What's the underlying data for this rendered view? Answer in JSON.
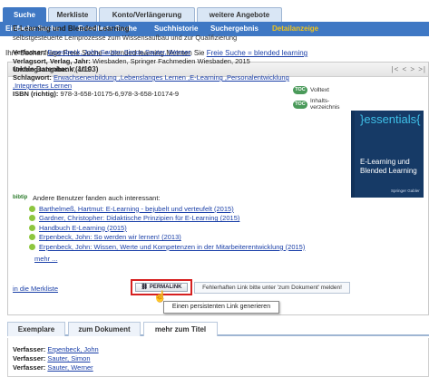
{
  "top_tabs": [
    {
      "label": "Suche",
      "active": true
    },
    {
      "label": "Merkliste",
      "active": false
    },
    {
      "label": "Konto/Verlängerung",
      "active": false
    },
    {
      "label": "weitere Angebote",
      "active": false
    }
  ],
  "subnav": [
    {
      "label": "Einfache Suche",
      "active": false
    },
    {
      "label": "Erweiterte Suche",
      "active": false
    },
    {
      "label": "Suchhistorie",
      "active": false
    },
    {
      "label": "Suchergebnis",
      "active": false
    },
    {
      "label": "Detailanzeige",
      "active": true
    }
  ],
  "search_info": {
    "text": "Ihre Suchanfrage Freie Suche = blended learning Meinten Sie",
    "suggestion": "Freie Suche = blended learning"
  },
  "panel": {
    "title": "lokale Datenbank (1/103)",
    "pager": "|< < > >|"
  },
  "record": {
    "title": "E-Learning und Blended Learning",
    "subtitle": "selbstgesteuerte Lernprozesse zum Wissensaufbau und zur Qualifizierung",
    "verfasser_label": "Verfasser:",
    "verfasser": "Erpenbeck, John,Sauter, Simon,Sauter, Werner",
    "verlagsort_label": "Verlagsort, Verlag, Jahr:",
    "verlagsort": "Wiesbaden, Springer Fachmedien Wiesbaden, 2015",
    "umfang_label": "Umfangsangabe:",
    "umfang": "V, 40 S.",
    "schlagwort_label": "Schlagwort:",
    "schlagwort_1": "Erwachsenenbildung ,Lebenslanges Lernen ,E-Learning ,Personalentwicklung",
    "schlagwort_2": ",Integriertes Lernen",
    "isbn_label": "ISBN (richtig):",
    "isbn": "978-3-658-10175-6,978-3-658-10174-9"
  },
  "side_buttons": [
    {
      "icon": "Volltext-icon",
      "badge": "TOC",
      "label": "Volltext"
    },
    {
      "icon": "inhaltsverzeichnis-icon",
      "badge": "TOC",
      "label": "Inhalts-verzeichnis"
    }
  ],
  "cover": {
    "brand": "}essentials{",
    "title": "E-Learning und Blended Learning",
    "publisher": "Springer Gabler"
  },
  "bibtip": {
    "logo": "bibtip",
    "text": "Andere Benutzer fanden auch interessant:",
    "items": [
      "Barthelmeß, Hartmut: E-Learning - bejubelt und verteufelt (2015)",
      "Gardner, Christopher: Didaktische Prinzipien für E-Learning (2015)",
      "Handbuch E-Learning (2015)",
      "Erpenbeck, John: So werden wir lernen! (2013)",
      "Erpenbeck, John: Wissen, Werte und Kompetenzen in der Mitarbeiterentwicklung (2015)"
    ],
    "more": "mehr ..."
  },
  "actions": {
    "merkliste": "in die Merkliste",
    "permalink": "PERMALINK",
    "fehler": "Fehlerhaften Link bitte unter 'zum Dokument' melden!",
    "tooltip": "Einen persistenten Link generieren"
  },
  "bottom_tabs": [
    {
      "label": "Exemplare",
      "active": false
    },
    {
      "label": "zum Dokument",
      "active": false
    },
    {
      "label": "mehr zum Titel",
      "active": true
    }
  ],
  "bottom_fields": [
    {
      "label": "Verfasser:",
      "value": "Erpenbeck, John"
    },
    {
      "label": "Verfasser:",
      "value": "Sauter, Simon"
    },
    {
      "label": "Verfasser:",
      "value": "Sauter, Werner"
    }
  ],
  "colors": {
    "accent": "#3f78c4",
    "active_subnav": "#f0c31a",
    "highlight": "#d62020"
  }
}
